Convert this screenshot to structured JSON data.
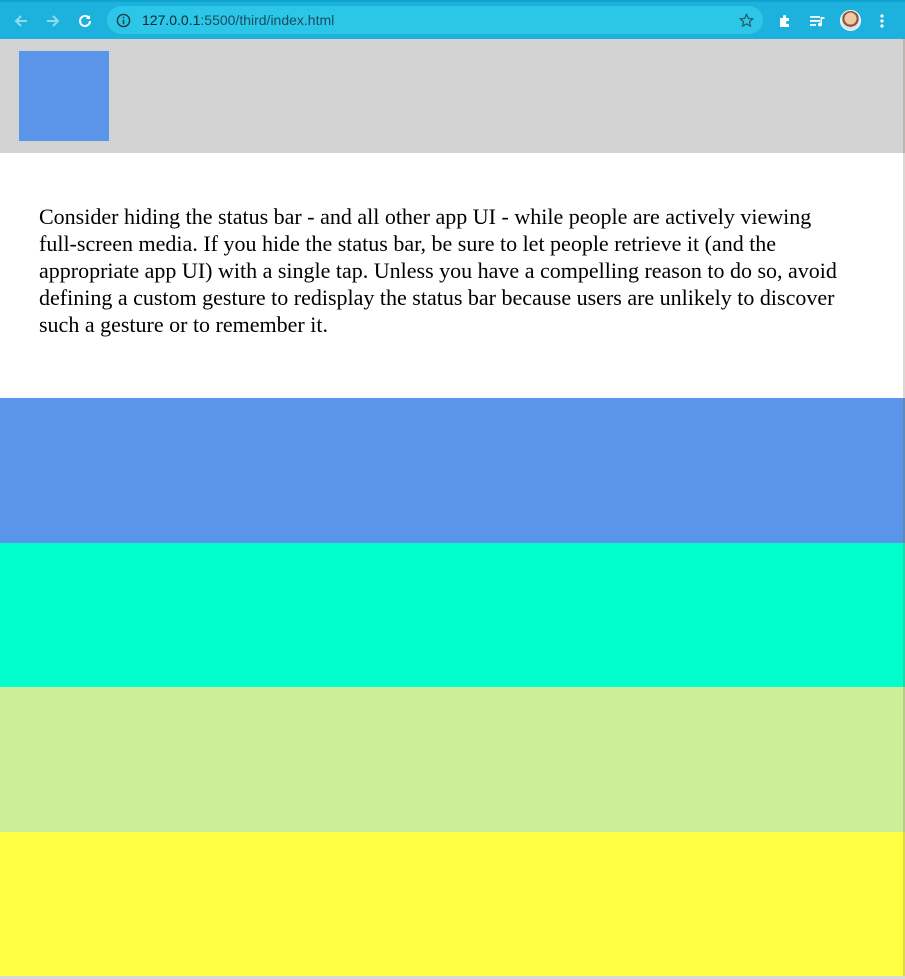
{
  "browser": {
    "url_host": "127.0.0.1",
    "url_path": ":5500/third/index.html",
    "icons": {
      "back": "arrow-left-icon",
      "forward": "arrow-right-icon",
      "reload": "reload-icon",
      "info": "info-icon",
      "bookmark": "star-icon",
      "extensions": "puzzle-icon",
      "media": "media-queue-icon",
      "profile": "avatar",
      "menu": "kebab-menu-icon"
    },
    "toolbar_color": "#1db2de"
  },
  "page": {
    "header_color": "#d3d3d3",
    "logo_color": "#5b95e9",
    "paragraph": "Consider hiding the status bar - and all other app UI - while people are actively viewing full-screen media. If you hide the status bar, be sure to let people retrieve it (and the appropriate app UI) with a single tap. Unless you have a compelling reason to do so, avoid defining a custom gesture to redisplay the status bar because users are unlikely to discover such a gesture or to remember it.",
    "bands": [
      {
        "color": "#5b95e9"
      },
      {
        "color": "#00ffcc"
      },
      {
        "color": "#ccee99"
      },
      {
        "color": "#ffff44"
      }
    ]
  }
}
